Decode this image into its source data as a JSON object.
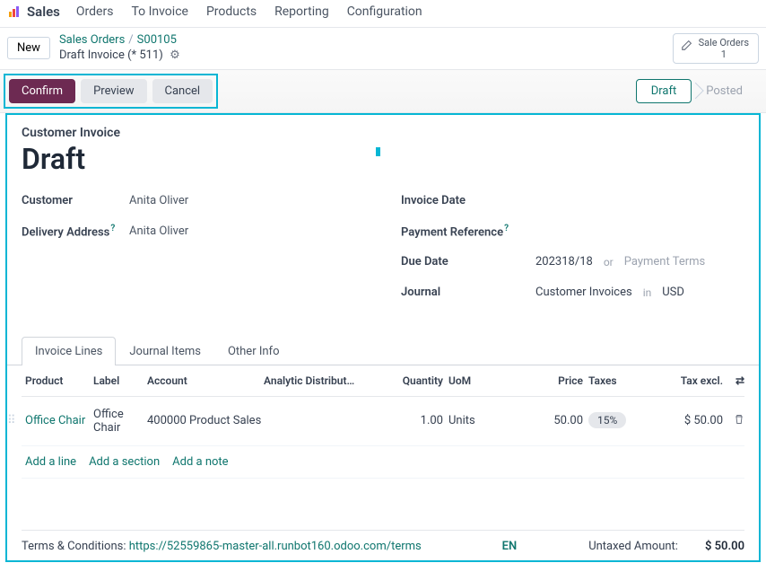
{
  "brand": "Sales",
  "topnav": [
    "Orders",
    "To Invoice",
    "Products",
    "Reporting",
    "Configuration"
  ],
  "new_btn": "New",
  "breadcrumb": {
    "l1": "Sales Orders",
    "l2": "S00105",
    "current": "Draft Invoice (* 511)"
  },
  "sale_orders": {
    "label": "Sale Orders",
    "count": "1"
  },
  "actions": {
    "confirm": "Confirm",
    "preview": "Preview",
    "cancel": "Cancel"
  },
  "status": {
    "draft": "Draft",
    "posted": "Posted"
  },
  "form": {
    "heading_small": "Customer Invoice",
    "heading_big": "Draft",
    "left": {
      "customer_label": "Customer",
      "customer_value": "Anita Oliver",
      "delivery_label": "Delivery Address",
      "delivery_value": "Anita Oliver"
    },
    "right": {
      "invoice_date_label": "Invoice Date",
      "payment_ref_label": "Payment Reference",
      "due_label": "Due Date",
      "due_value": "202318/18",
      "or": "or",
      "terms_placeholder": "Payment Terms",
      "journal_label": "Journal",
      "journal_value": "Customer Invoices",
      "in": "in",
      "currency": "USD"
    }
  },
  "tabs": [
    "Invoice Lines",
    "Journal Items",
    "Other Info"
  ],
  "grid": {
    "headers": {
      "product": "Product",
      "label": "Label",
      "account": "Account",
      "analytic": "Analytic Distribut…",
      "qty": "Quantity",
      "uom": "UoM",
      "price": "Price",
      "taxes": "Taxes",
      "taxexcl": "Tax excl."
    },
    "row": {
      "product": "Office Chair",
      "label": "Office Chair",
      "account": "400000 Product Sales",
      "qty": "1.00",
      "uom": "Units",
      "price": "50.00",
      "tax": "15%",
      "taxexcl": "$ 50.00"
    },
    "actions": {
      "add_line": "Add a line",
      "add_section": "Add a section",
      "add_note": "Add a note"
    }
  },
  "footer": {
    "terms_prefix": "Terms & Conditions: ",
    "terms_url": "https://52559865-master-all.runbot160.odoo.com/terms",
    "lang": "EN",
    "untaxed_label": "Untaxed Amount:",
    "untaxed_value": "$ 50.00"
  }
}
